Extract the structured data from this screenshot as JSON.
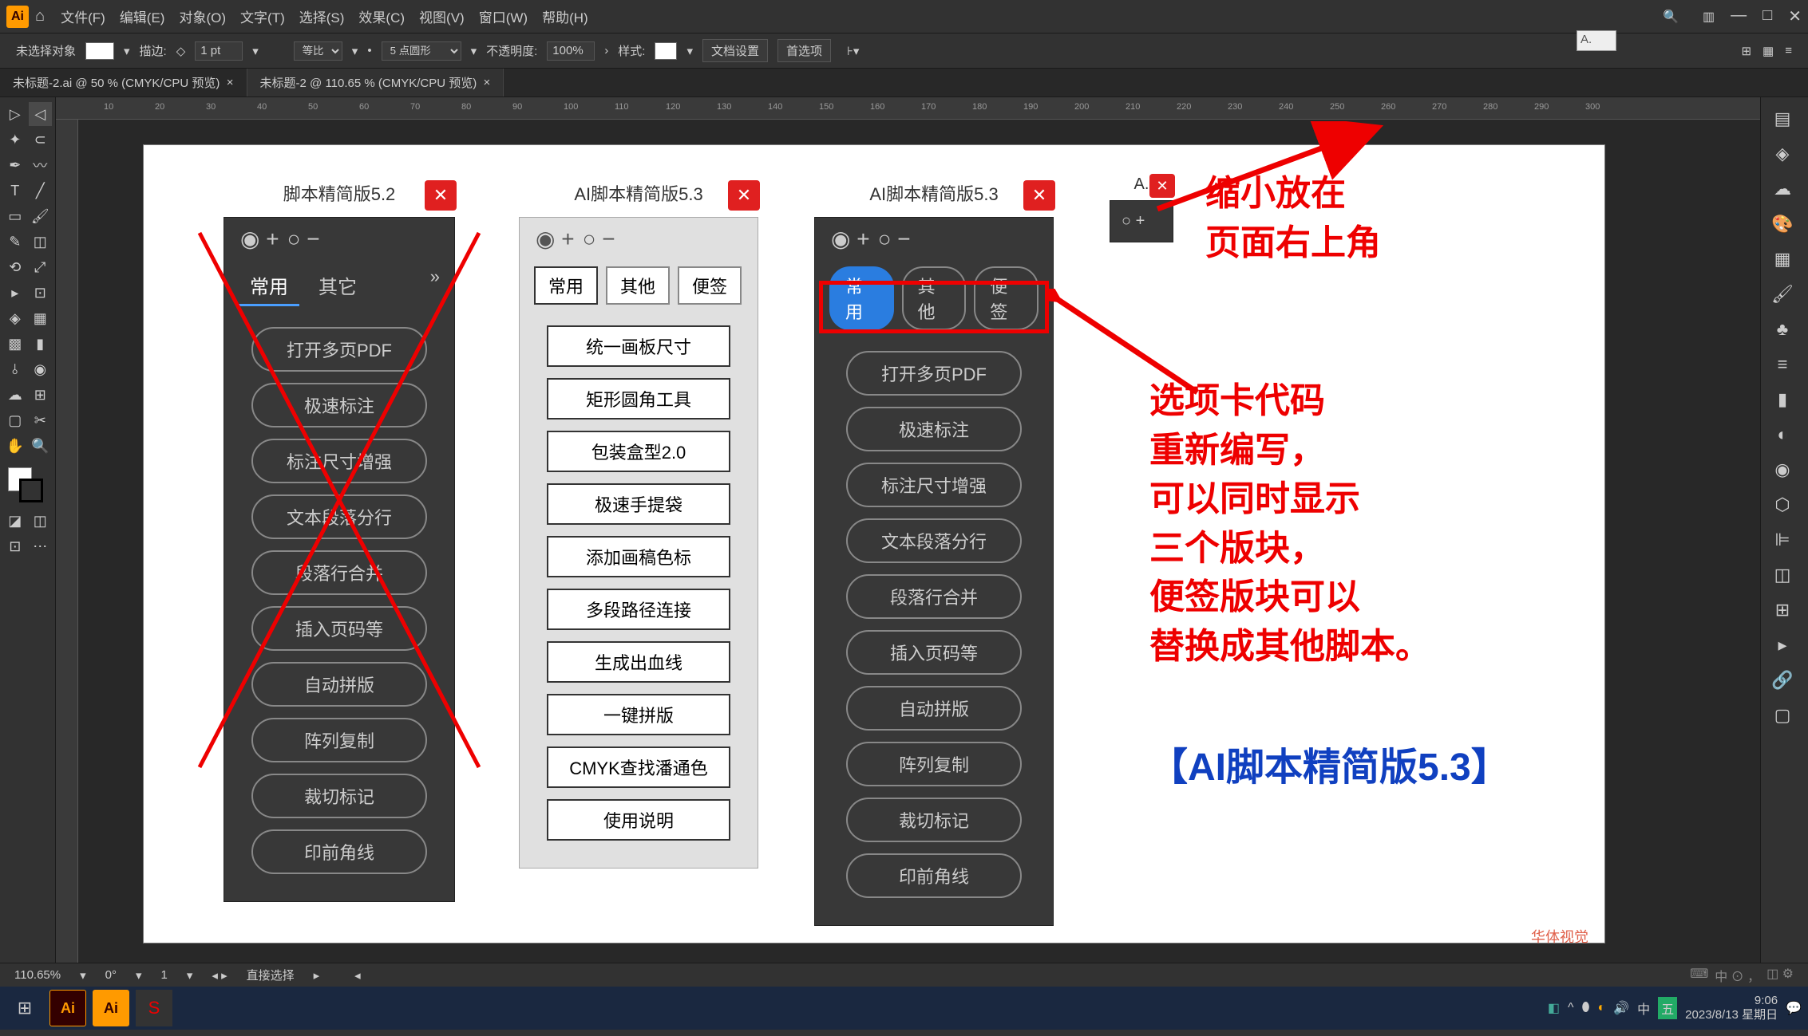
{
  "menubar": {
    "items": [
      "文件(F)",
      "编辑(E)",
      "对象(O)",
      "文字(T)",
      "选择(S)",
      "效果(C)",
      "视图(V)",
      "窗口(W)",
      "帮助(H)"
    ]
  },
  "floatTitle": "A.",
  "optbar": {
    "noSelect": "未选择对象",
    "stroke": "描边:",
    "strokeVal": "1 pt",
    "uniform": "等比",
    "brush": "5 点圆形",
    "opacity": "不透明度:",
    "opacityVal": "100%",
    "style": "样式:",
    "docSetup": "文档设置",
    "prefs": "首选项"
  },
  "tabs": [
    "未标题-2.ai @ 50 % (CMYK/CPU 预览)",
    "未标题-2 @ 110.65 % (CMYK/CPU 预览)"
  ],
  "ruler": [
    "10",
    "20",
    "30",
    "40",
    "50",
    "60",
    "70",
    "80",
    "90",
    "100",
    "110",
    "120",
    "130",
    "140",
    "150",
    "160",
    "170",
    "180",
    "190",
    "200",
    "210",
    "220",
    "230",
    "240",
    "250",
    "260",
    "270",
    "280",
    "290",
    "300"
  ],
  "panel52": {
    "title": "脚本精简版5.2",
    "tabs": [
      "常用",
      "其它"
    ],
    "buttons": [
      "打开多页PDF",
      "极速标注",
      "标注尺寸增强",
      "文本段落分行",
      "段落行合并",
      "插入页码等",
      "自动拼版",
      "阵列复制",
      "裁切标记",
      "印前角线"
    ]
  },
  "panel53light": {
    "title": "AI脚本精简版5.3",
    "tabs": [
      "常用",
      "其他",
      "便签"
    ],
    "buttons": [
      "统一画板尺寸",
      "矩形圆角工具",
      "包装盒型2.0",
      "极速手提袋",
      "添加画稿色标",
      "多段路径连接",
      "生成出血线",
      "一键拼版",
      "CMYK查找潘通色",
      "使用说明"
    ]
  },
  "panel53dark": {
    "title": "AI脚本精简版5.3",
    "tabs": [
      "常用",
      "其他",
      "便签"
    ],
    "buttons": [
      "打开多页PDF",
      "极速标注",
      "标注尺寸增强",
      "文本段落分行",
      "段落行合并",
      "插入页码等",
      "自动拼版",
      "阵列复制",
      "裁切标记",
      "印前角线"
    ]
  },
  "panelMini": {
    "title": "A."
  },
  "anno1": "缩小放在\n页面右上角",
  "anno2": "选项卡代码\n重新编写，\n可以同时显示\n三个版块，\n便签版块可以\n替换成其他脚本。",
  "anno3": "【AI脚本精简版5.3】",
  "statusbar": {
    "zoom": "110.65%",
    "angle": "0°",
    "artboard": "1",
    "tool": "直接选择"
  },
  "taskbar": {
    "tray": [
      "◧",
      "↑",
      "⬮",
      "◐",
      "🔊",
      "中",
      "🖵"
    ],
    "time": "9:06",
    "date": "2023/8/13 星期日"
  },
  "watermark": "华体视觉"
}
